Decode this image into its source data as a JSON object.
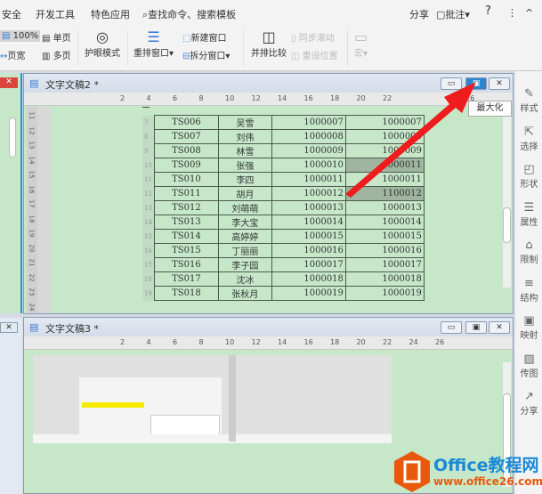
{
  "menu": {
    "items": [
      "安全",
      "开发工具",
      "特色应用"
    ],
    "search": "查找命令、搜索模板",
    "share": "分享",
    "comment": "批注",
    "help": "?",
    "more": "⋮",
    "collapse": "^"
  },
  "toolbar": {
    "zoom": "100%",
    "single_page": "单页",
    "page_width": "页宽",
    "multi_page": "多页",
    "eye_mode": "护眼模式",
    "rearrange": "重排窗口",
    "new_window": "新建窗口",
    "split_window": "拆分窗口",
    "side_by_side": "并排比较",
    "sync_scroll": "同步滚动",
    "reset_position": "重设位置",
    "macro": "宏"
  },
  "window2": {
    "title": "文字文稿2 *",
    "tooltip": "最大化",
    "ruler": [
      "2",
      "4",
      "6",
      "8",
      "10",
      "12",
      "14",
      "16",
      "18",
      "20",
      "22",
      "26"
    ],
    "vruler": [
      "11",
      "12",
      "13",
      "14",
      "15",
      "16",
      "17",
      "18",
      "19",
      "20",
      "21",
      "22",
      "23",
      "24"
    ],
    "rows": [
      {
        "n": "7",
        "id": "TS006",
        "name": "吴雪",
        "a": "1000007",
        "b": "1000007"
      },
      {
        "n": "8",
        "id": "TS007",
        "name": "刘伟",
        "a": "1000008",
        "b": "1000008"
      },
      {
        "n": "9",
        "id": "TS008",
        "name": "林雪",
        "a": "1000009",
        "b": "1000009"
      },
      {
        "n": "10",
        "id": "TS009",
        "name": "张强",
        "a": "1000010",
        "b": "1000011",
        "hl": true
      },
      {
        "n": "11",
        "id": "TS010",
        "name": "李四",
        "a": "1000011",
        "b": "1000011"
      },
      {
        "n": "12",
        "id": "TS011",
        "name": "胡月",
        "a": "1000012",
        "b": "1100012",
        "hl": true
      },
      {
        "n": "13",
        "id": "TS012",
        "name": "刘萌萌",
        "a": "1000013",
        "b": "1000013"
      },
      {
        "n": "14",
        "id": "TS013",
        "name": "李大宝",
        "a": "1000014",
        "b": "1000014"
      },
      {
        "n": "15",
        "id": "TS014",
        "name": "高婷婷",
        "a": "1000015",
        "b": "1000015"
      },
      {
        "n": "16",
        "id": "TS015",
        "name": "丁丽丽",
        "a": "1000016",
        "b": "1000016"
      },
      {
        "n": "17",
        "id": "TS016",
        "name": "李子园",
        "a": "1000017",
        "b": "1000017"
      },
      {
        "n": "18",
        "id": "TS017",
        "name": "沈冰",
        "a": "1000018",
        "b": "1000018"
      },
      {
        "n": "19",
        "id": "TS018",
        "name": "张秋月",
        "a": "1000019",
        "b": "1000019"
      }
    ]
  },
  "window3": {
    "title": "文字文稿3 *",
    "ruler": [
      "2",
      "4",
      "6",
      "8",
      "10",
      "12",
      "14",
      "16",
      "18",
      "20",
      "22",
      "24",
      "26"
    ]
  },
  "rightpanel": [
    {
      "icon": "pen-icon",
      "g": "✎",
      "label": "样式"
    },
    {
      "icon": "cursor-icon",
      "g": "⇱",
      "label": "选择"
    },
    {
      "icon": "shape-icon",
      "g": "◰",
      "label": "形状"
    },
    {
      "icon": "sliders-icon",
      "g": "☰",
      "label": "属性"
    },
    {
      "icon": "lock-icon",
      "g": "⌂",
      "label": "限制"
    },
    {
      "icon": "structure-icon",
      "g": "≡",
      "label": "结构"
    },
    {
      "icon": "map-icon",
      "g": "▣",
      "label": "映射"
    },
    {
      "icon": "image-icon",
      "g": "▨",
      "label": "传图"
    },
    {
      "icon": "share-icon",
      "g": "↗",
      "label": "分享"
    }
  ],
  "watermark": {
    "title": "Office教程网",
    "url": "www.office26.com"
  },
  "colors": {
    "doc_bg": "#c6e8c9",
    "arrow": "#ee1c1c",
    "watermark_orange": "#e8590c",
    "watermark_blue": "#1a8ad6"
  }
}
